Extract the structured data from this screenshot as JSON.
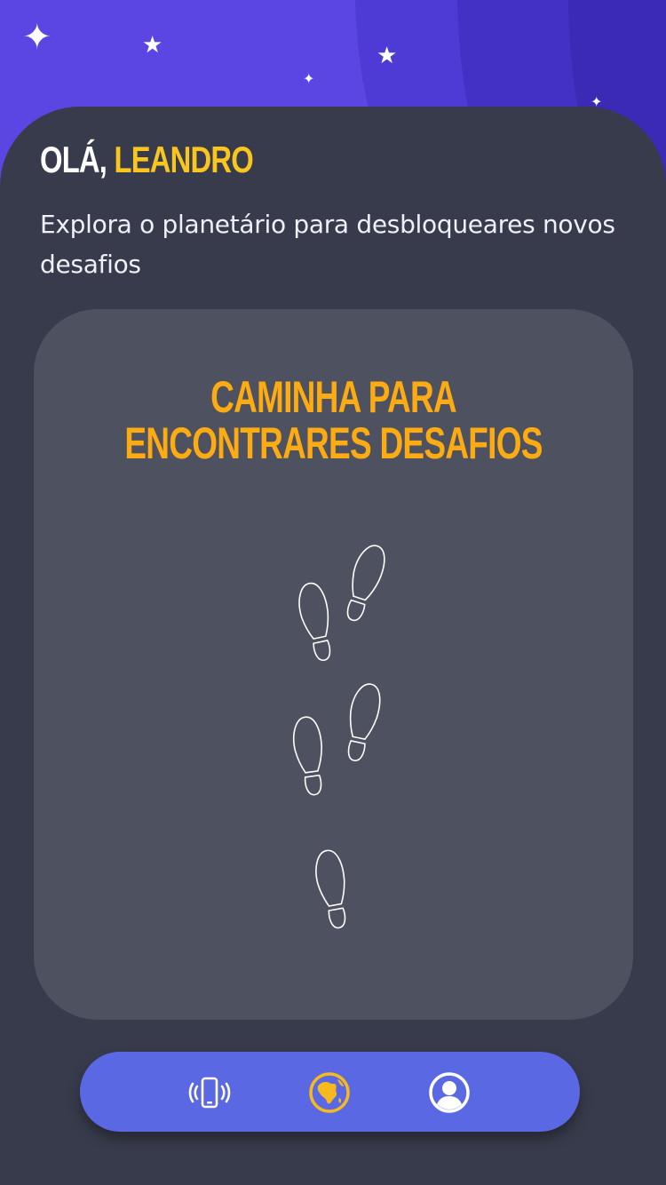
{
  "header": {
    "greeting_prefix": "OLÁ,",
    "user_name": "LEANDRO",
    "subtitle": "Explora o planetário para desbloqueares novos desafios"
  },
  "card": {
    "title": "CAMINHA PARA ENCONTRARES DESAFIOS",
    "icon": "footprints-icon"
  },
  "nav": {
    "items": [
      {
        "icon": "phone-vibrate-icon",
        "active": false
      },
      {
        "icon": "globe-icon",
        "active": true
      },
      {
        "icon": "user-profile-icon",
        "active": false
      }
    ]
  },
  "colors": {
    "sky": "#5b46e3",
    "background": "#383b4b",
    "card": "#4e515f",
    "accent_name": "#f9c51f",
    "accent_title": "#fdab12",
    "navbar": "#5a68e3",
    "active_icon": "#f6b91e"
  }
}
